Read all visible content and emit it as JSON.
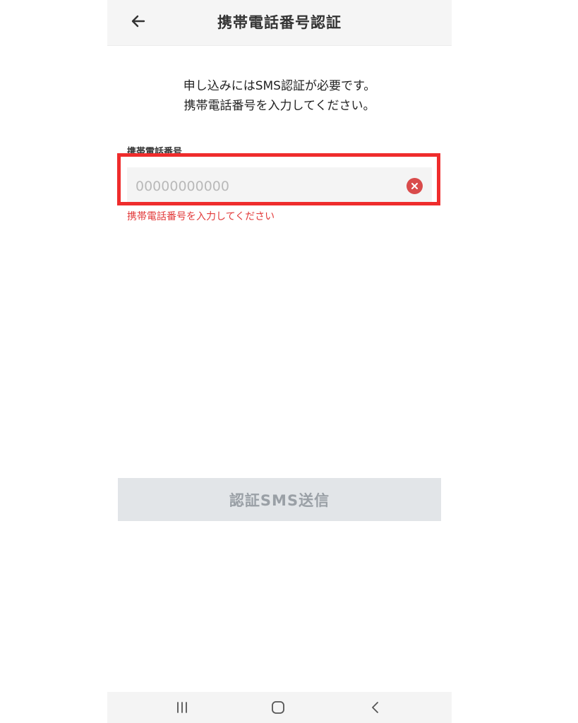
{
  "header": {
    "title": "携帯電話番号認証",
    "back_icon": "arrow-left-icon"
  },
  "intro": {
    "line1": "申し込みにはSMS認証が必要です。",
    "line2": "携帯電話番号を入力してください。"
  },
  "phone_field": {
    "label": "携帯電話番号",
    "value": "",
    "placeholder": "00000000000",
    "clear_icon": "clear-circle-icon",
    "error": "携帯電話番号を入力してください"
  },
  "submit": {
    "label": "認証SMS送信"
  },
  "nav": {
    "recent_icon": "recent-apps-icon",
    "home_icon": "home-icon",
    "back_icon": "back-icon"
  },
  "colors": {
    "highlight": "#ef2c2c",
    "error": "#e23a3a",
    "clear_button": "#d94b4b",
    "disabled_button_bg": "#e2e5e8",
    "disabled_button_text": "#9aa0a6"
  }
}
